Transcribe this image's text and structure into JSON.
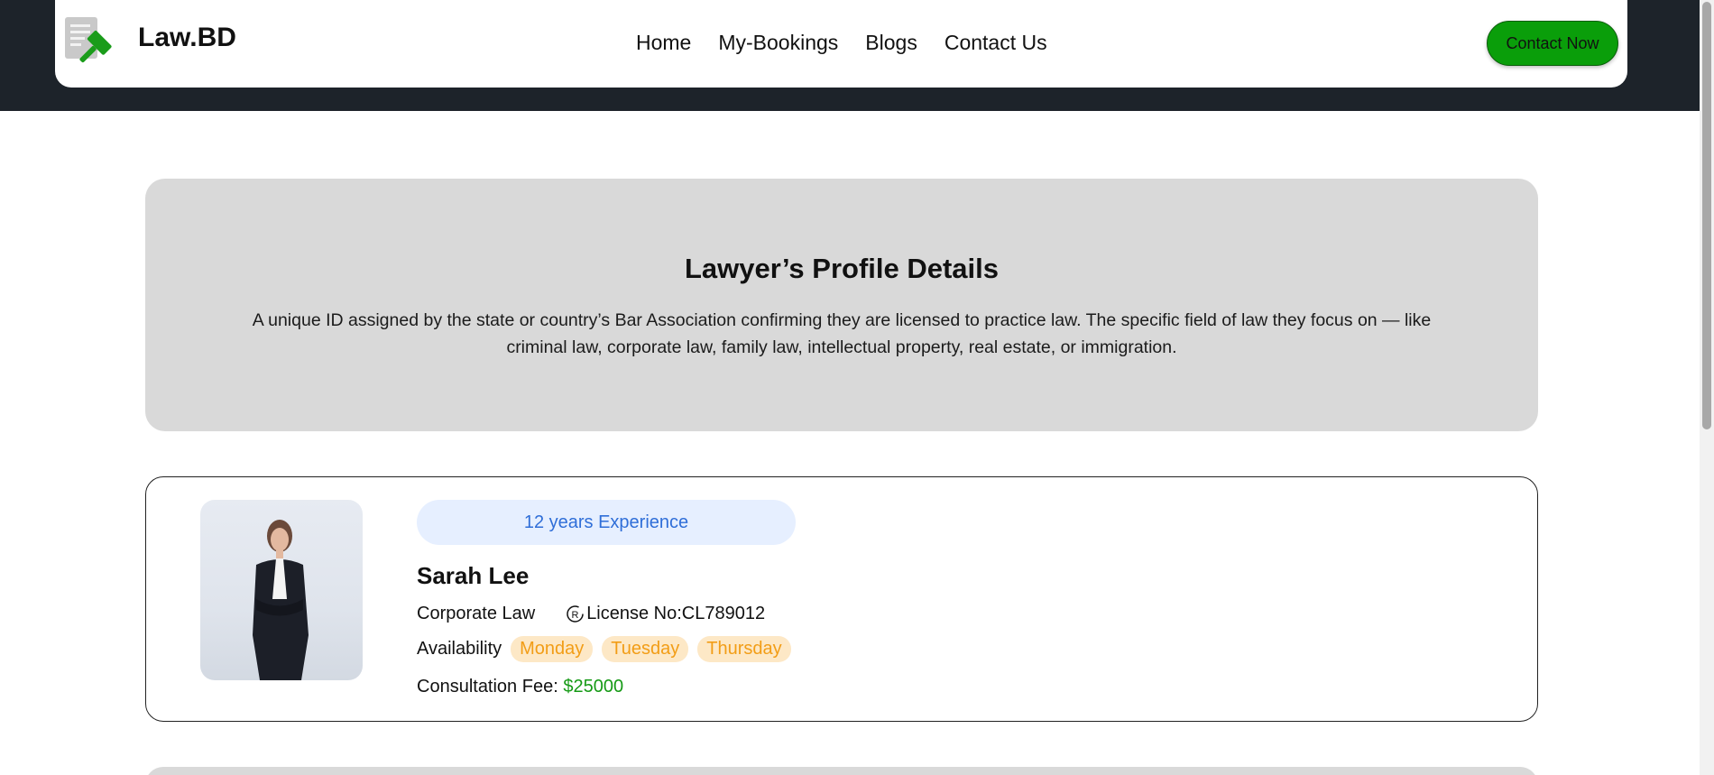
{
  "header": {
    "brand": "Law.BD",
    "nav": [
      {
        "label": "Home"
      },
      {
        "label": "My-Bookings"
      },
      {
        "label": "Blogs"
      },
      {
        "label": "Contact Us"
      }
    ],
    "cta_label": "Contact Now"
  },
  "banner": {
    "title": "Lawyer’s Profile Details",
    "description": "A unique ID assigned by the state or country’s Bar Association confirming they are licensed to practice law. The specific field of law they focus on — like criminal law, corporate law, family law, intellectual property, real estate, or immigration."
  },
  "profile": {
    "experience": "12 years Experience",
    "name": "Sarah Lee",
    "practice_area": "Corporate Law",
    "license_label": "License No:CL789012",
    "availability_label": "Availability",
    "days": [
      "Monday",
      "Tuesday",
      "Thursday"
    ],
    "fee_label": "Consultation Fee:",
    "fee_value": "$25000"
  },
  "colors": {
    "dark_bg": "#1d232a",
    "cta_green": "#0a9e0a",
    "banner_gray": "#d9d9d9",
    "experience_blue": "#2f6ed8",
    "day_orange": "#f29d16",
    "fee_green": "#159a15"
  },
  "icons": {
    "logo": "law-gavel-document-icon",
    "license": "registered-badge-icon"
  }
}
